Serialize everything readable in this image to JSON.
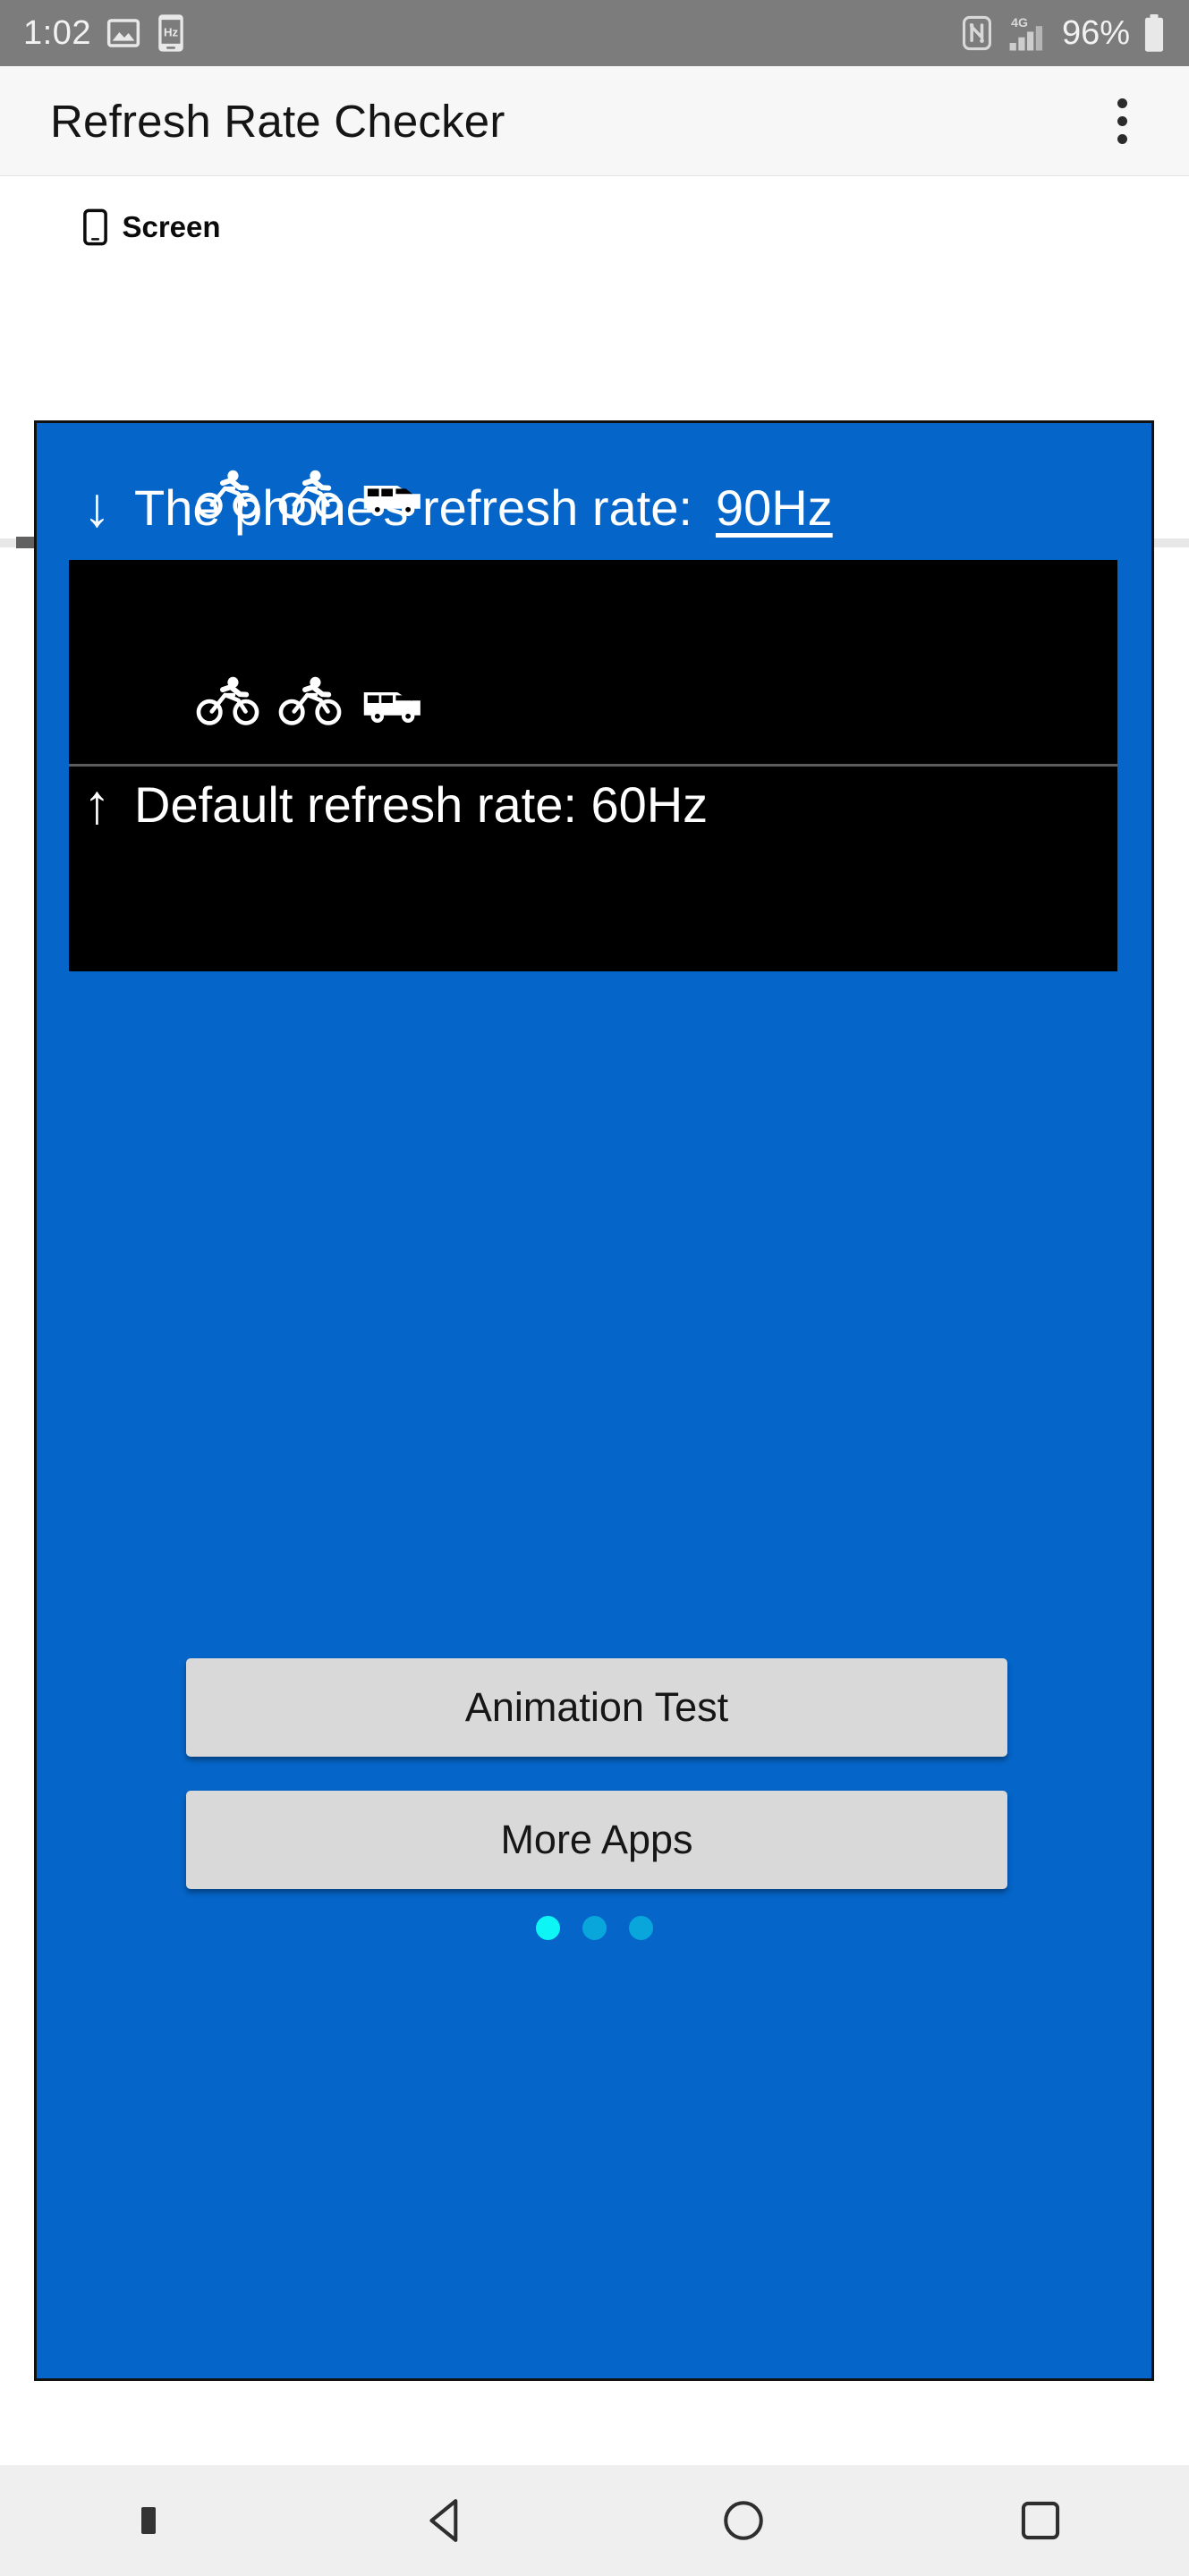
{
  "status_bar": {
    "time": "1:02",
    "battery_percent": "96%",
    "network": "4G",
    "icons": [
      "screenshot-icon",
      "hz-phone-icon",
      "nfc-icon",
      "signal-4g-icon",
      "battery-icon"
    ],
    "background_color": "#7c7c7c",
    "text_color": "#f2f2f2"
  },
  "app_bar": {
    "title": "Refresh Rate Checker",
    "overflow_menu": "more-options",
    "background_color": "#f7f7f7"
  },
  "tabs": {
    "items": [
      {
        "label": "Screen",
        "icon": "phone-icon",
        "selected": true
      }
    ],
    "indicator_color": "#616161"
  },
  "card": {
    "background_color": "#0565c8",
    "top_line": {
      "arrow": "↓",
      "text": "The phone's refresh rate: ",
      "value": "90Hz"
    },
    "bottom_line": {
      "arrow": "↑",
      "text": "Default refresh rate: 60Hz"
    },
    "animation_panel": {
      "background_color": "#000000",
      "rows": [
        {
          "vehicles": [
            "bicycle-icon",
            "bicycle-icon",
            "van-icon"
          ]
        },
        {
          "vehicles": [
            "bicycle-icon",
            "bicycle-icon",
            "van-icon"
          ]
        }
      ],
      "divider_color": "#5c5c5c"
    },
    "buttons": [
      {
        "label": "Animation Test",
        "name": "animation-test-button"
      },
      {
        "label": "More Apps",
        "name": "more-apps-button"
      }
    ],
    "page_dots": [
      {
        "active": true,
        "color": "#0df5f5"
      },
      {
        "active": false,
        "color": "#09a6dc"
      },
      {
        "active": false,
        "color": "#09a6dc"
      }
    ]
  },
  "nav_bar": {
    "background_color": "#efefef",
    "buttons": [
      "keyboard-hide-icon",
      "back-icon",
      "home-icon",
      "recents-icon"
    ]
  }
}
